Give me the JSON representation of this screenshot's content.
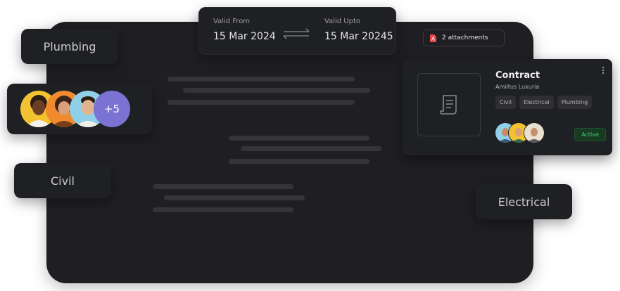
{
  "validity": {
    "from_label": "Valid From",
    "from_date": "15 Mar 2024",
    "upto_label": "Valid Upto",
    "upto_date": "15 Mar 20245"
  },
  "attachments": {
    "label": "2 attachments",
    "icon": "pdf-icon"
  },
  "tags": {
    "plumbing": "Plumbing",
    "civil": "Civil",
    "electrical": "Electrical"
  },
  "team": {
    "more_count": "+5",
    "avatars": [
      "avatar-woman-yellow",
      "avatar-woman-orange",
      "avatar-man-blue"
    ]
  },
  "contract": {
    "title": "Contract",
    "subtitle": "Amiltus Luxuria",
    "tags": [
      "Civil",
      "Electrical",
      "Plumbing"
    ],
    "status": "Active",
    "icon": "document-icon"
  },
  "colors": {
    "panel": "#1f1f23",
    "card": "#1f2024",
    "accent_purple": "#7b73d4",
    "status_green": "#4cc76f",
    "pdf_red": "#e5484d"
  }
}
